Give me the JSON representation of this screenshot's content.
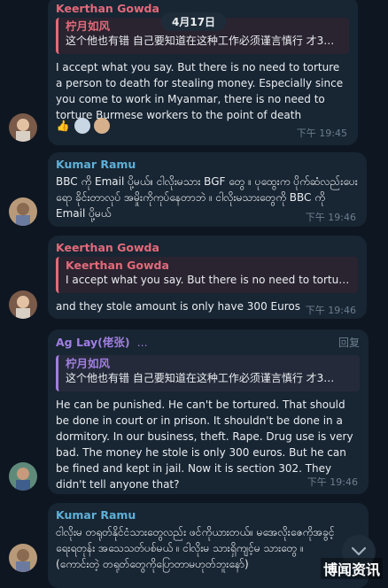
{
  "date_badge": "4月17日",
  "messages": [
    {
      "sender": "Keerthan Gowda",
      "sender_color": "#e36a7a",
      "reply_name": "柠月如风",
      "reply_text": "这个他也有错 自己要知道在这种工作必须谨言慎行 才3…",
      "text": "I accept what you say. But there is no need to torture a person to death for stealing money. Especially since you come to work in Myanmar, there is no need to torture Burmese workers to the point of death",
      "reactions": [
        "thumbs-up",
        "pictogram",
        "face"
      ],
      "time": "下午 19:45"
    },
    {
      "sender": "Kumar Ramu",
      "sender_color": "#5fb0d8",
      "text": "BBC ကို Email ပို့မယ်။ ငါလိုးမသား BGF တွေ ။ ပုထွေးက ပိုက်ဆံလည်းပေးရော ခိုင်းတာလုပ် အမှိုးကိုကုပ်နေတာဘဲ ။ ငါလိုးမသားတွေကို BBC ကို Email ပို့မယ်",
      "time": "下午 19:46"
    },
    {
      "sender": "Keerthan Gowda",
      "sender_color": "#e36a7a",
      "reply_name": "Keerthan Gowda",
      "reply_text": "I accept what you say. But there is no need to tortur…",
      "text": "and they stole amount is only have 300 Euros",
      "time": "下午 19:46"
    },
    {
      "sender": "Ag Lay(佬张)",
      "sender_color": "#a07fe0",
      "header_extra": "…",
      "reply_label": "回复",
      "reply_name": "柠月如风",
      "reply_text": "这个他也有错 自己要知道在这种工作必须谨言慎行 才3…",
      "text": "He can be punished. He can't be tortured. That should be done in court or in prison. It shouldn't be done in a dormitory. In our business, theft. Rape. Drug use is very bad. The money he stole is only 300 euros. But he can be fined and kept in jail. Now it is section 302. They didn't tell anyone that?",
      "time": "下午 19:46"
    },
    {
      "sender": "Kumar Ramu",
      "sender_color": "#5fb0d8",
      "text": "ငါလိုးမ တရုတ်နိုင်ငံသားတွေလည်း ဖင်ကိုယားတယ်။ မအေလိုးဇေကိုအခွင့်ရေးရတုန်း အသေသတ်ပစ်မယ် ။ ငါလိုးမ သားရှိကျင့်မ သားတွေ ။ (ကောင်းတဲ့ တရုတ်တွေကိုပြောတာမဟုတ်ဘူးနော်)"
    }
  ],
  "scroll_down_icon": "chevron-down-icon",
  "watermark": "博闻资讯"
}
